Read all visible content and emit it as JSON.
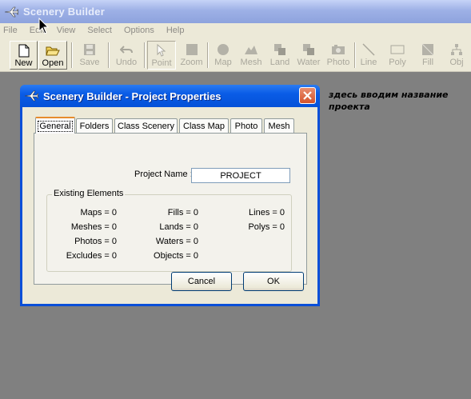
{
  "app": {
    "title": "Scenery Builder",
    "icon": "airplane-icon"
  },
  "menu": [
    "File",
    "Edit",
    "View",
    "Select",
    "Options",
    "Help"
  ],
  "toolbar": [
    {
      "label": "New",
      "icon": "new-file-icon",
      "state": "enabled"
    },
    {
      "label": "Open",
      "icon": "open-folder-icon",
      "state": "enabled"
    },
    {
      "label": "Save",
      "icon": "save-icon",
      "state": "disabled"
    },
    {
      "label": "Undo",
      "icon": "undo-icon",
      "state": "disabled"
    },
    {
      "label": "Point",
      "icon": "pointer-icon",
      "state": "pressed"
    },
    {
      "label": "Zoom",
      "icon": "zoom-icon",
      "state": "disabled"
    },
    {
      "label": "Map",
      "icon": "map-icon",
      "state": "disabled"
    },
    {
      "label": "Mesh",
      "icon": "mesh-icon",
      "state": "disabled"
    },
    {
      "label": "Land",
      "icon": "land-icon",
      "state": "disabled"
    },
    {
      "label": "Water",
      "icon": "water-icon",
      "state": "disabled"
    },
    {
      "label": "Photo",
      "icon": "photo-icon",
      "state": "disabled"
    },
    {
      "label": "Line",
      "icon": "line-icon",
      "state": "disabled"
    },
    {
      "label": "Poly",
      "icon": "poly-icon",
      "state": "disabled"
    },
    {
      "label": "Fill",
      "icon": "fill-icon",
      "state": "disabled"
    },
    {
      "label": "Obj",
      "icon": "object-icon",
      "state": "disabled"
    }
  ],
  "annotation": "здесь вводим название проекта",
  "dialog": {
    "title": "Scenery Builder - Project Properties",
    "tabs": [
      "General",
      "Folders",
      "Class Scenery",
      "Class Map",
      "Photo",
      "Mesh"
    ],
    "active_tab": "General",
    "project_name_label": "Project Name :",
    "project_name_value": "PROJECT",
    "group_title": "Existing Elements",
    "stats": [
      [
        "Maps = 0",
        "Fills = 0",
        "Lines = 0"
      ],
      [
        "Meshes = 0",
        "Lands = 0",
        "Polys = 0"
      ],
      [
        "Photos = 0",
        "Waters = 0"
      ],
      [
        "Excludes = 0",
        "Objects = 0"
      ]
    ],
    "cancel_label": "Cancel",
    "ok_label": "OK"
  },
  "colors": {
    "desktop": "#808080",
    "dialog_frame": "#0a4fd8",
    "close_button": "#d4532c",
    "active_tab_accent": "#e68b2c"
  }
}
